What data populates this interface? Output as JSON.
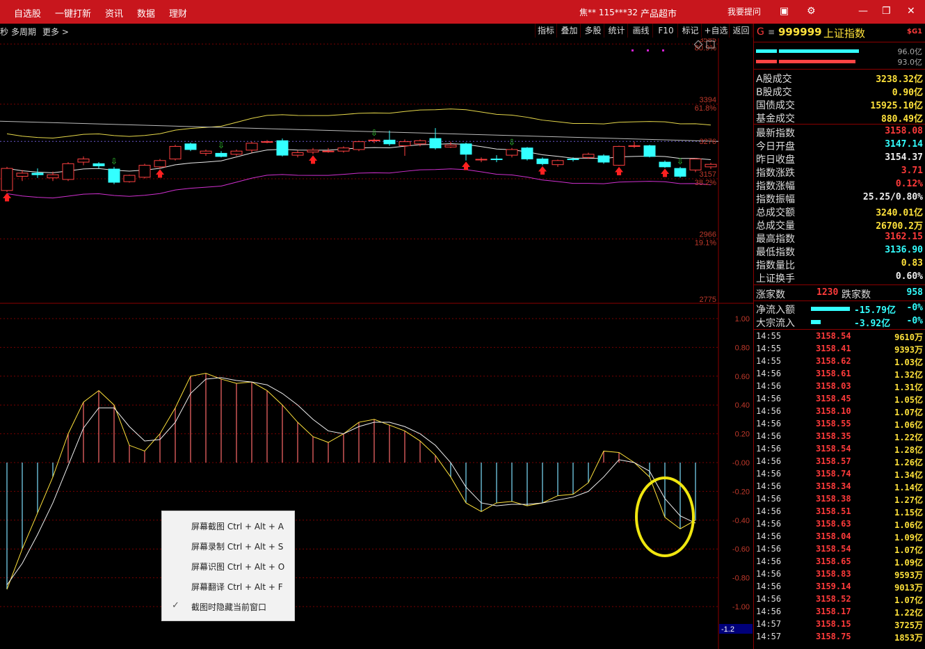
{
  "topbar": {
    "nav": [
      "自选股",
      "一键打新",
      "资讯",
      "数据",
      "理财"
    ],
    "account": "焦** 115***32",
    "product": "产品超市",
    "ask": "我要提问",
    "icons": [
      "cube-icon",
      "gear-icon",
      "minimize-icon",
      "restore-icon",
      "close-icon"
    ]
  },
  "subbar": {
    "left": [
      "秒",
      "多周期",
      "更多 >"
    ],
    "buttons": [
      "指标",
      "叠加",
      "多股",
      "统计",
      "画线",
      "F10",
      "标记",
      "+自选",
      "返回"
    ]
  },
  "price_axis": {
    "labels": [
      {
        "v": "3585",
        "pct": "80.9%"
      },
      {
        "v": "3394",
        "pct": "61.8%"
      },
      {
        "v": "3276",
        "pct": ""
      },
      {
        "v": "3157",
        "pct": "38.2%"
      },
      {
        "v": "2966",
        "pct": "19.1%"
      },
      {
        "v": "2775",
        "pct": ""
      }
    ]
  },
  "osc_axis": {
    "labels": [
      "1.00",
      "0.80",
      "0.60",
      "0.40",
      "0.20",
      "-0.00",
      "-0.20",
      "-0.40",
      "-0.60",
      "-0.80",
      "-1.00"
    ],
    "cursor_value": "-1.2"
  },
  "chart_data": {
    "type": "candlestick",
    "candles": [
      [
        3120,
        3190,
        3115,
        3195
      ],
      [
        3165,
        3175,
        3150,
        3185
      ],
      [
        3175,
        3170,
        3160,
        3190
      ],
      [
        3160,
        3170,
        3150,
        3180
      ],
      [
        3155,
        3205,
        3150,
        3210
      ],
      [
        3210,
        3220,
        3200,
        3228
      ],
      [
        3205,
        3198,
        3190,
        3210
      ],
      [
        3188,
        3146,
        3140,
        3195
      ],
      [
        3148,
        3168,
        3145,
        3170
      ],
      [
        3162,
        3200,
        3158,
        3205
      ],
      [
        3195,
        3215,
        3190,
        3220
      ],
      [
        3220,
        3260,
        3215,
        3265
      ],
      [
        3268,
        3250,
        3245,
        3272
      ],
      [
        3238,
        3245,
        3230,
        3250
      ],
      [
        3238,
        3228,
        3225,
        3245
      ],
      [
        3235,
        3245,
        3230,
        3250
      ],
      [
        3248,
        3270,
        3240,
        3275
      ],
      [
        3275,
        3275,
        3270,
        3280
      ],
      [
        3278,
        3232,
        3228,
        3285
      ],
      [
        3232,
        3240,
        3225,
        3248
      ],
      [
        3242,
        3248,
        3235,
        3255
      ],
      [
        3245,
        3245,
        3240,
        3255
      ],
      [
        3245,
        3255,
        3240,
        3260
      ],
      [
        3250,
        3275,
        3245,
        3278
      ],
      [
        3278,
        3280,
        3270,
        3285
      ],
      [
        3280,
        3268,
        3262,
        3310
      ],
      [
        3262,
        3275,
        3230,
        3282
      ],
      [
        3268,
        3278,
        3260,
        3282
      ],
      [
        3285,
        3255,
        3250,
        3318
      ],
      [
        3258,
        3264,
        3255,
        3275
      ],
      [
        3268,
        3235,
        3215,
        3272
      ],
      [
        3218,
        3219,
        3210,
        3225
      ],
      [
        3220,
        3219,
        3210,
        3232
      ],
      [
        3232,
        3250,
        3225,
        3255
      ],
      [
        3255,
        3220,
        3215,
        3258
      ],
      [
        3220,
        3205,
        3200,
        3225
      ],
      [
        3202,
        3215,
        3195,
        3218
      ],
      [
        3220,
        3218,
        3212,
        3225
      ],
      [
        3225,
        3235,
        3220,
        3240
      ],
      [
        3230,
        3210,
        3205,
        3235
      ],
      [
        3200,
        3260,
        3198,
        3262
      ],
      [
        3262,
        3262,
        3255,
        3275
      ],
      [
        3262,
        3228,
        3225,
        3265
      ],
      [
        3210,
        3195,
        3192,
        3215
      ],
      [
        3190,
        3165,
        3160,
        3195
      ],
      [
        3185,
        3220,
        3178,
        3222
      ],
      [
        3195,
        3203,
        3188,
        3208
      ]
    ],
    "macd": [
      -0.88,
      -0.6,
      -0.35,
      -0.1,
      0.2,
      0.42,
      0.5,
      0.4,
      0.12,
      0.08,
      0.2,
      0.38,
      0.6,
      0.62,
      0.58,
      0.55,
      0.56,
      0.5,
      0.4,
      0.28,
      0.18,
      0.14,
      0.2,
      0.28,
      0.3,
      0.26,
      0.22,
      0.15,
      0.05,
      -0.1,
      -0.28,
      -0.34,
      -0.28,
      -0.27,
      -0.3,
      -0.28,
      -0.23,
      -0.22,
      -0.14,
      0.08,
      0.07,
      0.0,
      -0.1,
      -0.38,
      -0.46,
      -0.4
    ],
    "signal": [
      -0.85,
      -0.7,
      -0.5,
      -0.28,
      -0.02,
      0.24,
      0.38,
      0.38,
      0.25,
      0.15,
      0.16,
      0.28,
      0.48,
      0.58,
      0.59,
      0.57,
      0.56,
      0.54,
      0.48,
      0.4,
      0.3,
      0.22,
      0.2,
      0.25,
      0.28,
      0.28,
      0.25,
      0.2,
      0.12,
      0.0,
      -0.17,
      -0.28,
      -0.3,
      -0.29,
      -0.29,
      -0.28,
      -0.26,
      -0.24,
      -0.2,
      -0.1,
      0.02,
      0.0,
      -0.06,
      -0.25,
      -0.37,
      -0.42
    ]
  },
  "quote": {
    "code": "999999",
    "name": "上证指数",
    "bars": [
      "96.0亿",
      "93.0亿"
    ],
    "turnovers": [
      {
        "k": "A股成交",
        "v": "3238.32亿"
      },
      {
        "k": "B股成交",
        "v": "0.90亿"
      },
      {
        "k": "国债成交",
        "v": "15925.10亿"
      },
      {
        "k": "基金成交",
        "v": "880.49亿"
      }
    ],
    "stats": [
      {
        "k": "最新指数",
        "v": "3158.08",
        "c": "up"
      },
      {
        "k": "今日开盘",
        "v": "3147.14",
        "c": "dn"
      },
      {
        "k": "昨日收盘",
        "v": "3154.37",
        "c": "wh"
      },
      {
        "k": "指数涨跌",
        "v": "3.71",
        "c": "up"
      },
      {
        "k": "指数涨幅",
        "v": "0.12%",
        "c": "up"
      },
      {
        "k": "指数振幅",
        "v": "25.25/0.80%",
        "c": "wh"
      },
      {
        "k": "总成交额",
        "v": "3240.01亿",
        "c": "yl"
      },
      {
        "k": "总成交量",
        "v": "26700.2万",
        "c": "yl"
      },
      {
        "k": "最高指数",
        "v": "3162.15",
        "c": "up"
      },
      {
        "k": "最低指数",
        "v": "3136.90",
        "c": "dn"
      },
      {
        "k": "指数量比",
        "v": "0.83",
        "c": "yl"
      },
      {
        "k": "上证换手",
        "v": "0.60%",
        "c": "wh"
      }
    ],
    "adv": "1230",
    "adv_label": "涨家数",
    "dec": "958",
    "dec_label": "跌家数",
    "flows": [
      {
        "k": "净流入额",
        "v": "-15.79亿",
        "p": "-0%"
      },
      {
        "k": "大宗流入",
        "v": "-3.92亿",
        "p": "-0%"
      }
    ]
  },
  "ticks": [
    [
      "14:55",
      "3158.54",
      "9610万"
    ],
    [
      "14:55",
      "3158.41",
      "9393万"
    ],
    [
      "14:55",
      "3158.62",
      "1.03亿"
    ],
    [
      "14:56",
      "3158.61",
      "1.32亿"
    ],
    [
      "14:56",
      "3158.03",
      "1.31亿"
    ],
    [
      "14:56",
      "3158.45",
      "1.05亿"
    ],
    [
      "14:56",
      "3158.10",
      "1.07亿"
    ],
    [
      "14:56",
      "3158.55",
      "1.06亿"
    ],
    [
      "14:56",
      "3158.35",
      "1.22亿"
    ],
    [
      "14:56",
      "3158.54",
      "1.28亿"
    ],
    [
      "14:56",
      "3158.57",
      "1.26亿"
    ],
    [
      "14:56",
      "3158.74",
      "1.34亿"
    ],
    [
      "14:56",
      "3158.34",
      "1.14亿"
    ],
    [
      "14:56",
      "3158.38",
      "1.27亿"
    ],
    [
      "14:56",
      "3158.51",
      "1.15亿"
    ],
    [
      "14:56",
      "3158.63",
      "1.06亿"
    ],
    [
      "14:56",
      "3158.04",
      "1.09亿"
    ],
    [
      "14:56",
      "3158.54",
      "1.07亿"
    ],
    [
      "14:56",
      "3158.65",
      "1.09亿"
    ],
    [
      "14:56",
      "3158.83",
      "9593万"
    ],
    [
      "14:56",
      "3159.14",
      "9013万"
    ],
    [
      "14:56",
      "3158.52",
      "1.07亿"
    ],
    [
      "14:56",
      "3158.17",
      "1.22亿"
    ],
    [
      "14:57",
      "3158.15",
      "3725万"
    ],
    [
      "14:57",
      "3158.75",
      "1853万"
    ]
  ],
  "context_menu": {
    "items": [
      "屏幕截图 Ctrl + Alt + A",
      "屏幕录制 Ctrl + Alt + S",
      "屏幕识图 Ctrl + Alt + O",
      "屏幕翻译 Ctrl + Alt + F",
      "截图时隐藏当前窗口"
    ],
    "checked_index": 4
  }
}
